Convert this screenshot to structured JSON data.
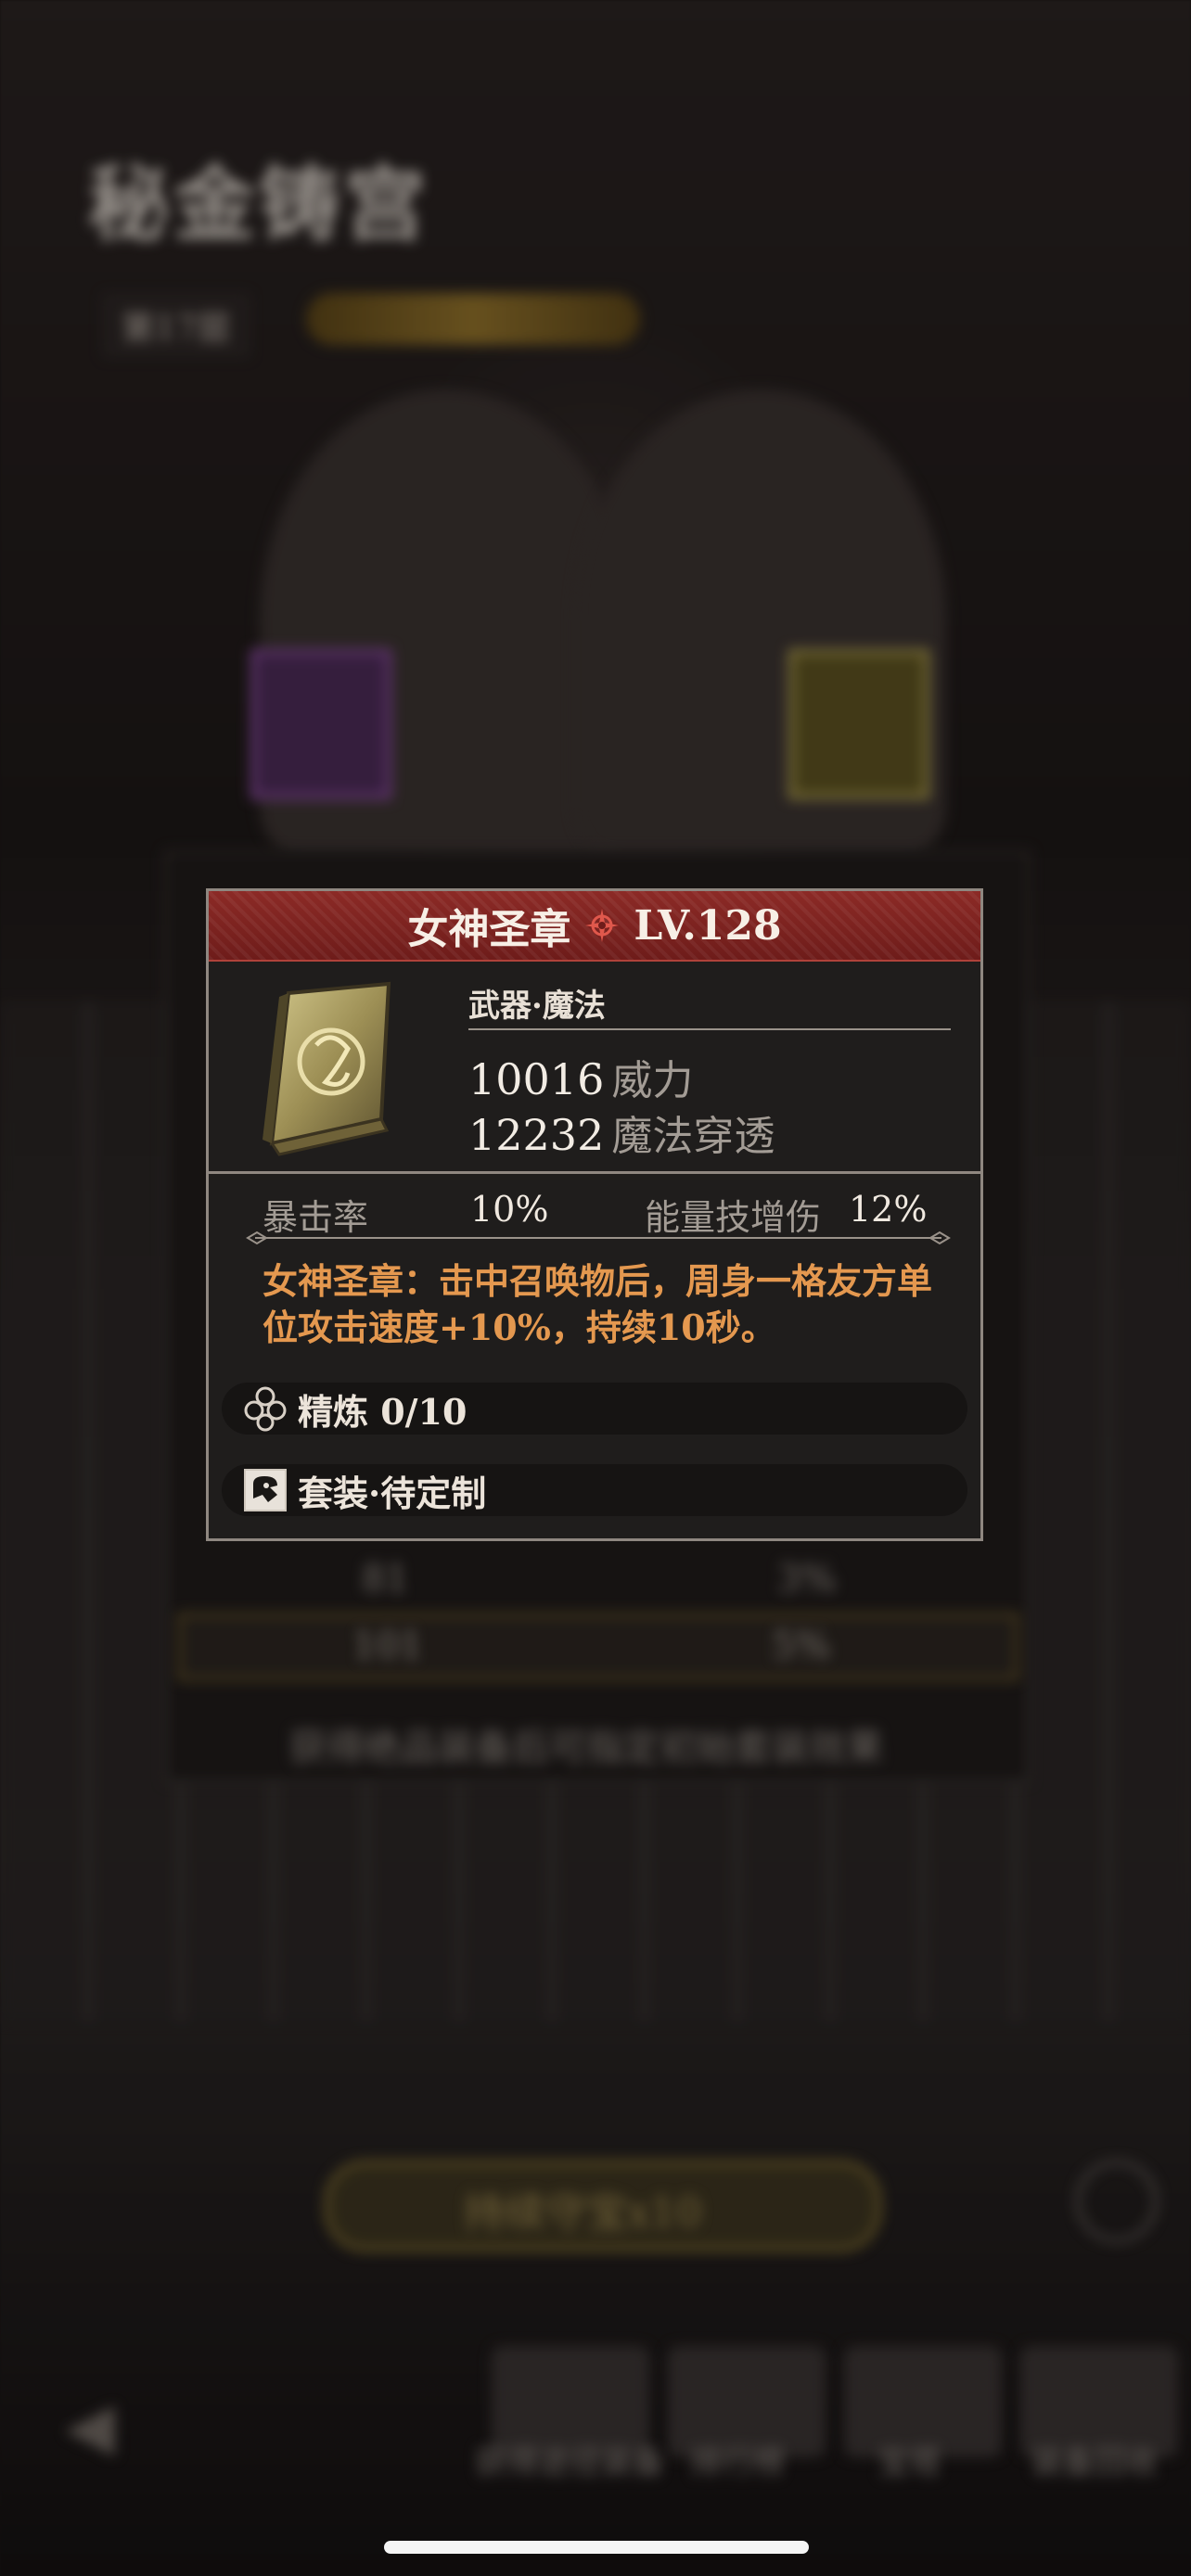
{
  "background": {
    "title": "秘金铸宫",
    "floor": "第17层",
    "reward_row_1": {
      "left": "81",
      "right": "3%"
    },
    "reward_row_2": {
      "left": "101",
      "right": "5%"
    },
    "note": "获得绝品装备后可指定初始套装效果",
    "bottom_button": "持续守宝x10",
    "nav_labels": [
      "获得途径装备",
      "排行榜",
      "宝塔",
      "装备回收"
    ]
  },
  "item": {
    "name": "女神圣章",
    "level": "LV.128",
    "type": "武器·魔法",
    "stats": [
      {
        "value": "10016",
        "label": "威力"
      },
      {
        "value": "12232",
        "label": "魔法穿透"
      }
    ],
    "crit_label": "暴击率",
    "crit_value": "10%",
    "energy_label": "能量技增伤",
    "energy_value": "12%",
    "description": "女神圣章：击中召唤物后，周身一格友方单位攻击速度+10%，持续10秒。",
    "refine": "精炼 0/10",
    "set": "套装·待定制"
  },
  "colors": {
    "header_red": "#8c2a26",
    "description_orange": "#e4984f",
    "panel_bg": "#1f1d1c",
    "border_gray": "#8f8780"
  },
  "icons": {
    "rune": "rune-icon",
    "book": "tome-item-icon",
    "refine": "refine-cluster-icon",
    "set": "set-custom-icon"
  }
}
